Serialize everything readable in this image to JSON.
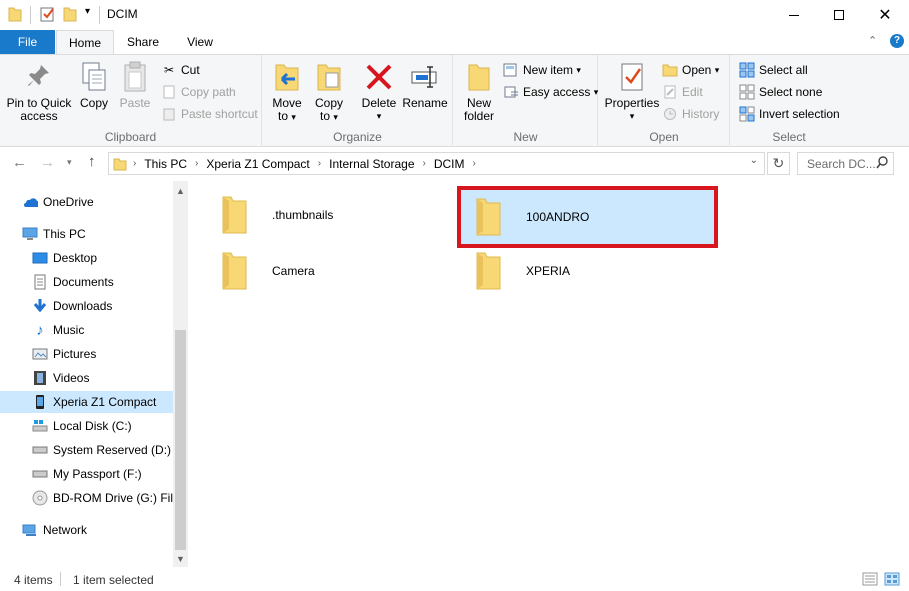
{
  "window": {
    "title": "DCIM"
  },
  "tabs": {
    "file": "File",
    "home": "Home",
    "share": "Share",
    "view": "View"
  },
  "ribbon": {
    "clipboard": {
      "label": "Clipboard",
      "pin_line1": "Pin to Quick",
      "pin_line2": "access",
      "copy": "Copy",
      "paste": "Paste",
      "cut": "Cut",
      "copy_path": "Copy path",
      "paste_shortcut": "Paste shortcut"
    },
    "organize": {
      "label": "Organize",
      "move_line1": "Move",
      "move_line2": "to",
      "copy_line1": "Copy",
      "copy_line2": "to",
      "delete": "Delete",
      "rename": "Rename"
    },
    "new": {
      "label": "New",
      "folder_line1": "New",
      "folder_line2": "folder",
      "new_item": "New item",
      "easy_access": "Easy access"
    },
    "open": {
      "label": "Open",
      "properties": "Properties",
      "open": "Open",
      "edit": "Edit",
      "history": "History"
    },
    "select": {
      "label": "Select",
      "select_all": "Select all",
      "select_none": "Select none",
      "invert": "Invert selection"
    }
  },
  "address": {
    "crumbs": [
      "This PC",
      "Xperia Z1 Compact",
      "Internal Storage",
      "DCIM"
    ],
    "search_placeholder": "Search DC..."
  },
  "nav": {
    "onedrive": "OneDrive",
    "thispc": "This PC",
    "desktop": "Desktop",
    "documents": "Documents",
    "downloads": "Downloads",
    "music": "Music",
    "pictures": "Pictures",
    "videos": "Videos",
    "xperia": "Xperia Z1 Compact",
    "localdisk": "Local Disk (C:)",
    "sysreserved": "System Reserved (D:)",
    "passport": "My Passport (F:)",
    "bdrom": "BD-ROM Drive (G:) File",
    "network": "Network"
  },
  "files": [
    {
      "name": ".thumbnails"
    },
    {
      "name": "100ANDRO"
    },
    {
      "name": "Camera"
    },
    {
      "name": "XPERIA"
    }
  ],
  "status": {
    "count": "4 items",
    "selected": "1 item selected"
  },
  "colors": {
    "accent": "#1979ca",
    "selection": "#cce8ff",
    "highlight_box": "#d8161f",
    "folder": "#f8d775"
  }
}
